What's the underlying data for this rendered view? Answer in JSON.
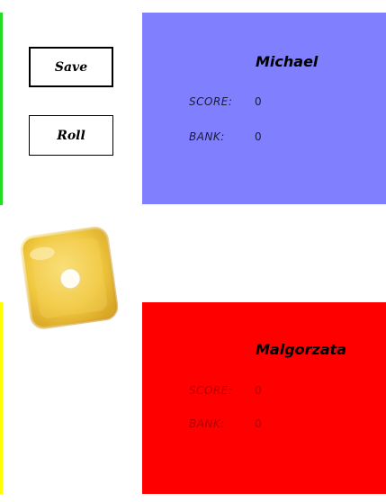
{
  "colors": {
    "turn_bar_top": "#22dd22",
    "turn_bar_bottom": "#ffff00",
    "player1_panel": "#8080ff",
    "player2_panel": "#ff0000",
    "die_face": "#f0c840"
  },
  "controls": {
    "save_label": "Save",
    "roll_label": "Roll"
  },
  "die": {
    "value": 1,
    "icon": "die-face-one-icon"
  },
  "players": [
    {
      "name": "Michael",
      "score_label": "SCORE:",
      "score": "0",
      "bank_label": "BANK:",
      "bank": "0"
    },
    {
      "name": "Malgorzata",
      "score_label": "SCORE:",
      "score": "0",
      "bank_label": "BANK:",
      "bank": "0"
    }
  ]
}
